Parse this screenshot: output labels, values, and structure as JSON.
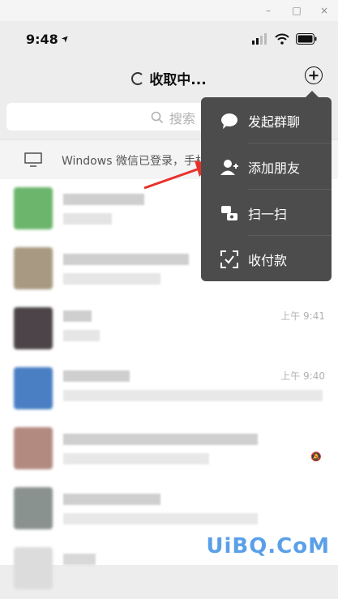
{
  "window": {
    "minimize": "–",
    "maximize": "□",
    "close": "×"
  },
  "status_bar": {
    "time": "9:48",
    "location_arrow": "➤"
  },
  "navbar": {
    "title": "收取中..."
  },
  "search": {
    "placeholder": "搜索"
  },
  "login_banner": {
    "text": "Windows 微信已登录，手机"
  },
  "menu": {
    "items": [
      {
        "label": "发起群聊",
        "icon": "chat-bubble-icon"
      },
      {
        "label": "添加朋友",
        "icon": "add-friend-icon"
      },
      {
        "label": "扫一扫",
        "icon": "scan-icon"
      },
      {
        "label": "收付款",
        "icon": "payment-icon"
      }
    ]
  },
  "chats": [
    {
      "time": ""
    },
    {
      "time": ""
    },
    {
      "time": "上午 9:41"
    },
    {
      "time": "上午 9:40"
    },
    {
      "time": ""
    },
    {
      "time": ""
    }
  ],
  "watermark": "UiBQ.CoM",
  "colors": {
    "menu_bg": "#4c4c4c",
    "annotation_arrow": "#e8302a",
    "watermark": "#5aa0e8"
  }
}
